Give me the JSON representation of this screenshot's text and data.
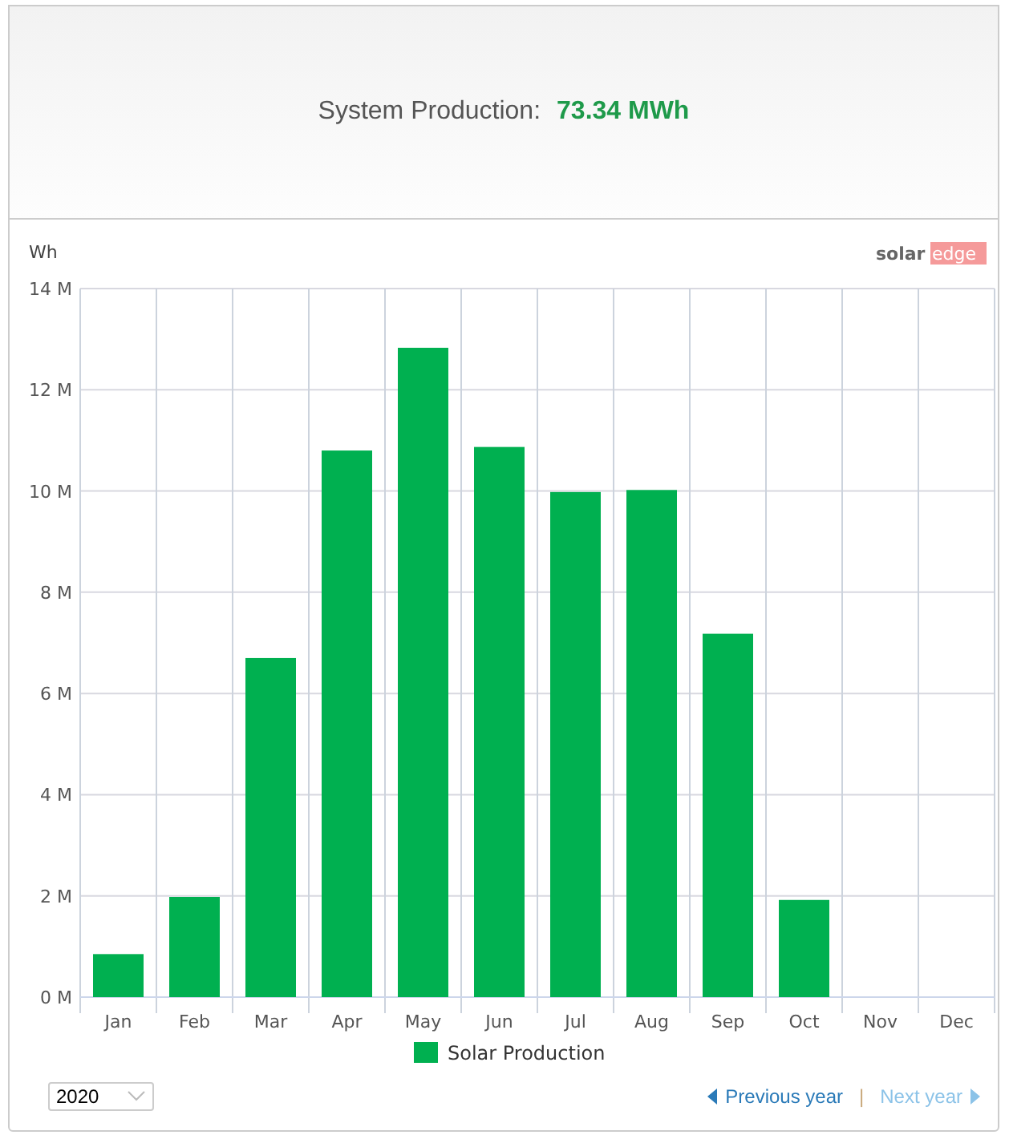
{
  "summary": {
    "label": "System Production:",
    "value": "73.34 MWh"
  },
  "logo": {
    "part_1": "solar",
    "part_2": "edge"
  },
  "chart": {
    "unit_label": "Wh",
    "chart_data": {
      "type": "bar",
      "categories": [
        "Jan",
        "Feb",
        "Mar",
        "Apr",
        "May",
        "Jun",
        "Jul",
        "Aug",
        "Sep",
        "Oct",
        "Nov",
        "Dec"
      ],
      "series": [
        {
          "name": "Solar Production",
          "color": "#00b050",
          "values": [
            850000,
            1980000,
            6700000,
            10800000,
            12830000,
            10870000,
            9980000,
            10020000,
            7180000,
            1920000,
            null,
            null
          ]
        }
      ],
      "ylim": [
        0,
        14000000
      ],
      "grid": true,
      "yticks": [
        {
          "value": 0,
          "label": "0 M"
        },
        {
          "value": 2000000,
          "label": "2 M"
        },
        {
          "value": 4000000,
          "label": "4 M"
        },
        {
          "value": 6000000,
          "label": "6 M"
        },
        {
          "value": 8000000,
          "label": "8 M"
        },
        {
          "value": 10000000,
          "label": "10 M"
        },
        {
          "value": 12000000,
          "label": "12 M"
        },
        {
          "value": 14000000,
          "label": "14 M"
        }
      ]
    }
  },
  "year_select": {
    "value": "2020"
  },
  "nav": {
    "previous": {
      "label": "Previous year",
      "disabled": false
    },
    "separator": "|",
    "next": {
      "label": "Next year",
      "disabled": true
    }
  }
}
